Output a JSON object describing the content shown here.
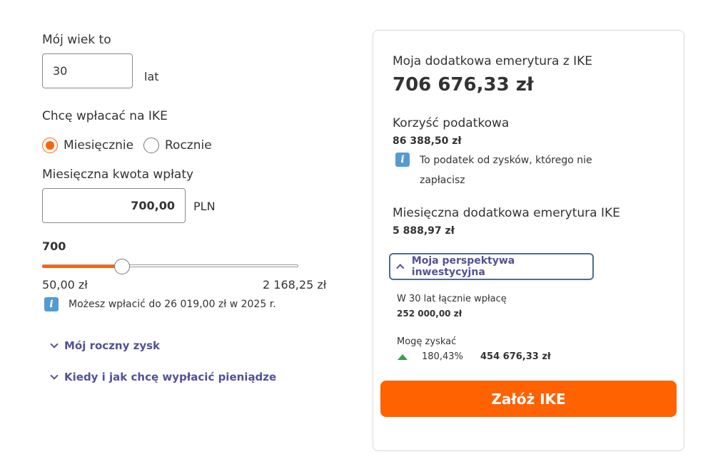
{
  "age": {
    "label": "Mój wiek to",
    "value": "30",
    "unit": "lat"
  },
  "frequency": {
    "label": "Chcę wpłacać na IKE",
    "options": [
      {
        "label": "Miesięcznie",
        "selected": true
      },
      {
        "label": "Rocznie",
        "selected": false
      }
    ]
  },
  "amount": {
    "label": "Miesięczna kwota wpłaty",
    "value": "700,00",
    "currency": "PLN"
  },
  "slider": {
    "current_label": "700",
    "min_label": "50,00 zł",
    "max_label": "2 168,25 zł",
    "min": 50,
    "max": 2168.25,
    "value": 700
  },
  "limit_info": "Możesz wpłacić do 26 019,00 zł w 2025 r.",
  "links": {
    "annual_profit": "Mój roczny zysk",
    "withdraw": "Kiedy i jak chcę wypłacić pieniądze"
  },
  "summary": {
    "pension_label": "Moja dodatkowa emerytura z IKE",
    "pension_value": "706 676,33 zł",
    "tax_benefit_label": "Korzyść podatkowa",
    "tax_benefit_value": "86 388,50 zł",
    "tax_info": "To podatek od zysków, którego nie zapłacisz",
    "monthly_pension_label": "Miesięczna dodatkowa emerytura IKE",
    "monthly_pension_value": "5 888,97 zł",
    "perspective_button": "Moja perspektywa inwestycyjna",
    "deposits_label": "W 30 lat łącznie wpłacę",
    "deposits_value": "252 000,00 zł",
    "gain_label": "Mogę zyskać",
    "gain_percent": "180,43%",
    "gain_value": "454 676,33 zł",
    "cta_label": "Załóż IKE"
  },
  "colors": {
    "accent": "#ff6200",
    "link": "#525199",
    "info": "#559bd1",
    "positive": "#3b9a4a"
  }
}
